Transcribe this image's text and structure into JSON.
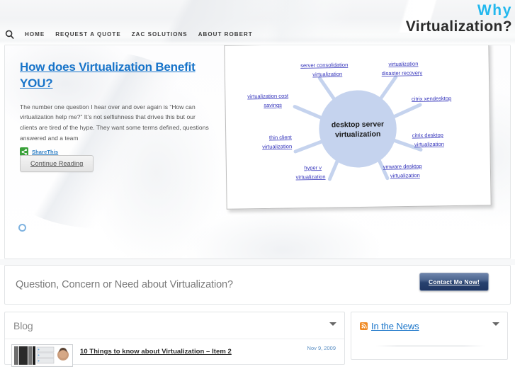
{
  "header": {
    "logo_line1": "Why",
    "logo_line2": "Virtualization?",
    "logo_color_accent": "#23b8ee",
    "logo_color_main": "#2b2b2b",
    "search_icon": "search-icon",
    "nav": [
      {
        "label": "Home"
      },
      {
        "label": "Request a Quote"
      },
      {
        "label": "ZAC Solutions"
      },
      {
        "label": "About Robert"
      }
    ]
  },
  "hero": {
    "title": "How does Virtualization Benefit YOU?",
    "body": "The number one question I hear over and over again is “How can virtualization help me?”  It’s not selfishness that drives this but our clients are tired of the hype.  They want some terms defined, questions answered and a team",
    "share_label": "ShareThis",
    "share_icon": "share-icon",
    "continue_label": "Continue Reading",
    "slider_dot": "slider-indicator",
    "link_color": "#1874c9"
  },
  "diagram": {
    "center_line1": "desktop server",
    "center_line2": "virtualization",
    "circle_color": "#c5d3ee",
    "label_color": "#3333bb",
    "nodes": [
      {
        "id": "server-consolidation",
        "line1": "server consolidation",
        "line2": "virtualization"
      },
      {
        "id": "disaster-recovery",
        "line1": "virtualization",
        "line2": "disaster recovery"
      },
      {
        "id": "cost-savings",
        "line1": "virtualization cost",
        "line2": "savings"
      },
      {
        "id": "citrix-xendesktop",
        "line1": "citrix xendesktop",
        "line2": ""
      },
      {
        "id": "thin-client",
        "line1": "thin client",
        "line2": "virtualization"
      },
      {
        "id": "citrix-desktop",
        "line1": "citrix desktop",
        "line2": "virtualization"
      },
      {
        "id": "hyper-v",
        "line1": "hyper v",
        "line2": "virtualization"
      },
      {
        "id": "vmware-desktop",
        "line1": "vmware desktop",
        "line2": "virtualization"
      }
    ]
  },
  "cta": {
    "text": "Question, Concern or Need about Virtualization?",
    "button_label": "Contact Me Now!",
    "button_color": "#27416e"
  },
  "blog": {
    "title": "Blog",
    "caret_icon": "chevron-down-icon",
    "posts": [
      {
        "title": "10 Things to know about Virtualization – Item 2",
        "date": "Nov 9, 2009",
        "thumb": "server-rack-thumbnail",
        "excerpt": ""
      }
    ]
  },
  "news": {
    "title": "In the News",
    "rss_icon": "rss-icon",
    "caret_icon": "chevron-down-icon",
    "rss_color": "#f08a24"
  }
}
